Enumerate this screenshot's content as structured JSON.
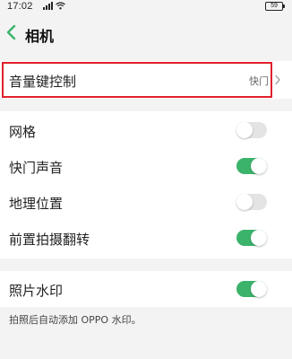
{
  "status_bar": {
    "time": "17:02",
    "battery": "59",
    "icons": [
      "signal-icon",
      "wifi-icon",
      "battery-icon"
    ]
  },
  "header": {
    "back_icon": "chevron-left-icon",
    "title": "相机"
  },
  "colors": {
    "accent": "#3bb36a",
    "highlight": "#e0202a",
    "background": "#f3f3f3"
  },
  "settings": {
    "volume_key": {
      "label": "音量键控制",
      "value": "快门",
      "icon": "chevron-right-icon"
    },
    "grid": {
      "label": "网格",
      "on": false
    },
    "shutter_sound": {
      "label": "快门声音",
      "on": true
    },
    "location": {
      "label": "地理位置",
      "on": false
    },
    "front_mirror": {
      "label": "前置拍摄翻转",
      "on": true
    },
    "watermark": {
      "label": "照片水印",
      "on": true
    },
    "watermark_note": "拍照后自动添加 OPPO 水印。"
  }
}
